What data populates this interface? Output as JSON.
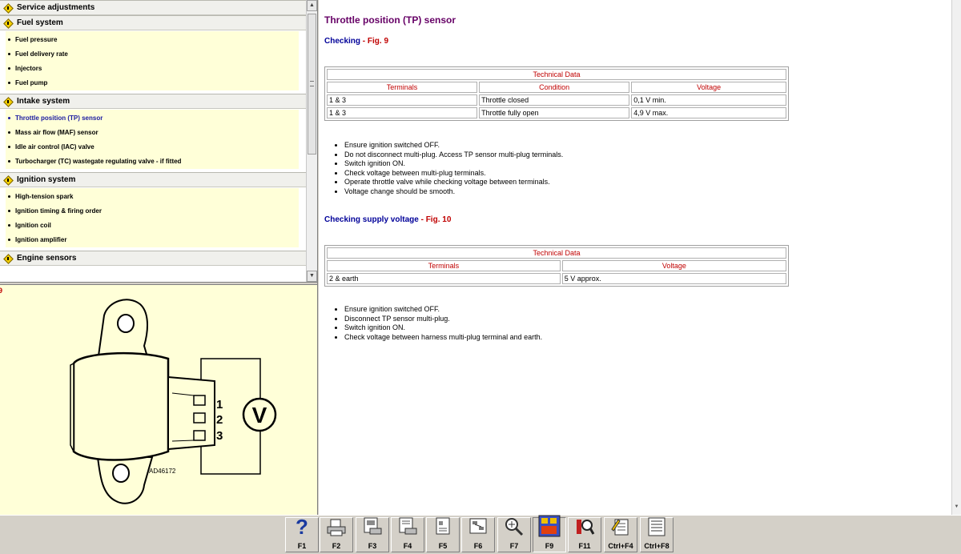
{
  "tree": {
    "sections": [
      {
        "title": "Service adjustments",
        "items": []
      },
      {
        "title": "Fuel system",
        "items": [
          "Fuel pressure",
          "Fuel delivery rate",
          "Injectors",
          "Fuel pump"
        ]
      },
      {
        "title": "Intake system",
        "items": [
          "Throttle position (TP) sensor",
          "Mass air flow (MAF) sensor",
          "Idle air control (IAC) valve",
          "Turbocharger (TC) wastegate regulating valve - if fitted"
        ]
      },
      {
        "title": "Ignition system",
        "items": [
          "High-tension spark",
          "Ignition timing & firing order",
          "Ignition coil",
          "Ignition amplifier"
        ]
      },
      {
        "title": "Engine sensors",
        "items": []
      }
    ],
    "active_item": "Throttle position (TP) sensor"
  },
  "figure": {
    "number": "9",
    "terminal_labels": [
      "1",
      "2",
      "3"
    ],
    "meter_symbol": "V",
    "code": "AD46172"
  },
  "content": {
    "title": "Throttle position (TP) sensor",
    "check1": {
      "heading": "Checking",
      "sep": " - ",
      "fig": "Fig. 9",
      "table": {
        "caption": "Technical Data",
        "headers": [
          "Terminals",
          "Condition",
          "Voltage"
        ],
        "rows": [
          [
            "1 & 3",
            "Throttle closed",
            "0,1 V min."
          ],
          [
            "1 & 3",
            "Throttle fully open",
            "4,9 V max."
          ]
        ]
      },
      "steps": [
        "Ensure ignition switched OFF.",
        "Do not disconnect multi-plug. Access TP sensor multi-plug terminals.",
        "Switch ignition ON.",
        "Check voltage between multi-plug terminals.",
        "Operate throttle valve while checking voltage between terminals.",
        "Voltage change should be smooth."
      ]
    },
    "check2": {
      "heading": "Checking supply voltage",
      "sep": " - ",
      "fig": "Fig. 10",
      "table": {
        "caption": "Technical Data",
        "headers": [
          "Terminals",
          "Voltage"
        ],
        "rows": [
          [
            "2 & earth",
            "5 V approx."
          ]
        ]
      },
      "steps": [
        "Ensure ignition switched OFF.",
        "Disconnect TP sensor multi-plug.",
        "Switch ignition ON.",
        "Check voltage between harness multi-plug terminal and earth."
      ]
    }
  },
  "toolbar": {
    "buttons": [
      {
        "label": "F1",
        "icon": "help-icon",
        "pressed": false
      },
      {
        "label": "F2",
        "icon": "printer-icon",
        "pressed": false
      },
      {
        "label": "F3",
        "icon": "print-page-icon",
        "pressed": false
      },
      {
        "label": "F4",
        "icon": "print-document-icon",
        "pressed": false
      },
      {
        "label": "F5",
        "icon": "page-icon",
        "pressed": false
      },
      {
        "label": "F6",
        "icon": "diagram-icon",
        "pressed": false
      },
      {
        "label": "F7",
        "icon": "magnifier-icon",
        "pressed": false
      },
      {
        "label": "F9",
        "icon": "figure-view-icon",
        "pressed": true
      },
      {
        "label": "F11",
        "icon": "search-icon",
        "pressed": false
      },
      {
        "label": "Ctrl+F4",
        "icon": "notepad-pen-icon",
        "pressed": false
      },
      {
        "label": "Ctrl+F8",
        "icon": "list-icon",
        "pressed": false
      }
    ]
  },
  "colors": {
    "title": "#660066",
    "heading": "#000099",
    "fig_ref": "#c00000",
    "panel_bg": "#ffffd8",
    "active_item": "#1a1aa0"
  }
}
